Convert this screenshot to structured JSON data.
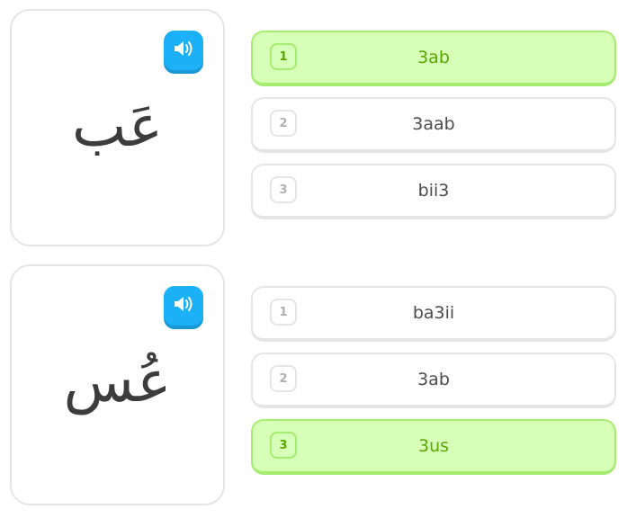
{
  "colors": {
    "speaker": "#1cb0f6",
    "selected_bg": "#d7ffb8",
    "selected_border": "#a5ed6e",
    "selected_text": "#58a700",
    "card_border": "#e5e5e5"
  },
  "pairs": [
    {
      "arabic": "عَب",
      "speaker_icon": "speaker-icon",
      "options": [
        {
          "num": "1",
          "text": "3ab",
          "selected": true
        },
        {
          "num": "2",
          "text": "3aab",
          "selected": false
        },
        {
          "num": "3",
          "text": "bii3",
          "selected": false
        }
      ]
    },
    {
      "arabic": "عُس",
      "speaker_icon": "speaker-icon",
      "options": [
        {
          "num": "1",
          "text": "ba3ii",
          "selected": false
        },
        {
          "num": "2",
          "text": "3ab",
          "selected": false
        },
        {
          "num": "3",
          "text": "3us",
          "selected": true
        }
      ]
    }
  ]
}
